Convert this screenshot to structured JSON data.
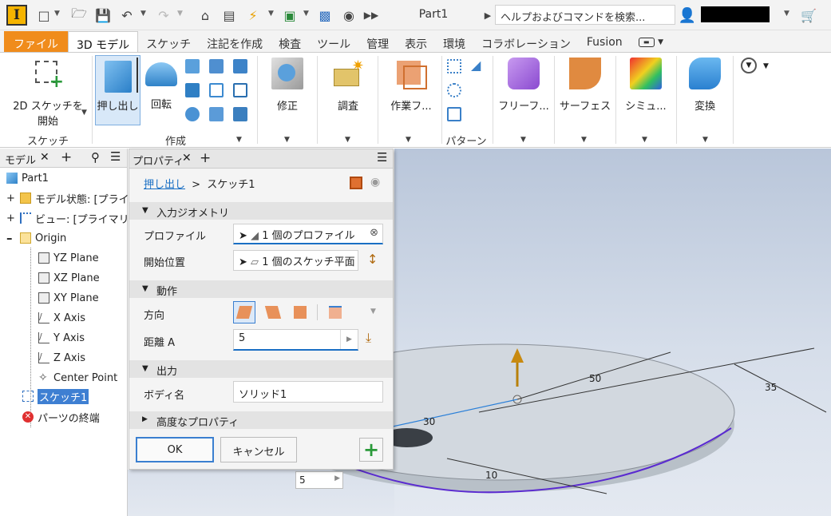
{
  "app": {
    "logo": "I",
    "title": "Part1"
  },
  "search": {
    "placeholder": "ヘルプおよびコマンドを検索..."
  },
  "tabs": [
    {
      "label": "ファイル"
    },
    {
      "label": "3D モデル"
    },
    {
      "label": "スケッチ"
    },
    {
      "label": "注記を作成"
    },
    {
      "label": "検査"
    },
    {
      "label": "ツール"
    },
    {
      "label": "管理"
    },
    {
      "label": "表示"
    },
    {
      "label": "環境"
    },
    {
      "label": "コラボレーション"
    },
    {
      "label": "Fusion"
    }
  ],
  "ribbon": {
    "sketch2d_line1": "2D スケッチを",
    "sketch2d_line2": "開始",
    "group_sketch": "スケッチ",
    "extrude": "押し出し",
    "revolve": "回転",
    "group_create": "作成",
    "modify": "修正",
    "explore": "調査",
    "workfeatures": "作業フ...",
    "group_pattern": "パターン",
    "freeform": "フリーフ...",
    "surface": "サーフェス",
    "simulation": "シミュ...",
    "convert": "変換"
  },
  "browser": {
    "tab_label": "モデル",
    "items": [
      {
        "label": "Part1"
      },
      {
        "label": "モデル状態: [プライ"
      },
      {
        "label": "ビュー: [プライマリ]"
      },
      {
        "label": "Origin"
      },
      {
        "label": "YZ Plane"
      },
      {
        "label": "XZ Plane"
      },
      {
        "label": "XY Plane"
      },
      {
        "label": "X Axis"
      },
      {
        "label": "Y Axis"
      },
      {
        "label": "Z Axis"
      },
      {
        "label": "Center Point"
      },
      {
        "label": "スケッチ1"
      },
      {
        "label": "パーツの終端"
      }
    ]
  },
  "properties": {
    "tab_label": "プロパティ",
    "breadcrumb_link": "押し出し",
    "breadcrumb_sep": ">",
    "breadcrumb_current": "スケッチ1",
    "sect_input": "入力ジオメトリ",
    "profile_label": "プロファイル",
    "profile_value": "1 個のプロファイル",
    "start_label": "開始位置",
    "start_value": "1 個のスケッチ平面",
    "sect_behavior": "動作",
    "direction_label": "方向",
    "distance_label": "距離 A",
    "distance_value": "5",
    "sect_output": "出力",
    "body_label": "ボディ名",
    "body_value": "ソリッド1",
    "sect_advanced": "高度なプロパティ",
    "ok": "OK",
    "cancel": "キャンセル"
  },
  "viewport": {
    "dims": [
      "50",
      "35",
      "30",
      "10"
    ],
    "input_value": "5"
  },
  "colors": {
    "file_tab": "#f08c1c",
    "accent": "#1a6fc4",
    "extrude_active": "#d8e8f8"
  }
}
